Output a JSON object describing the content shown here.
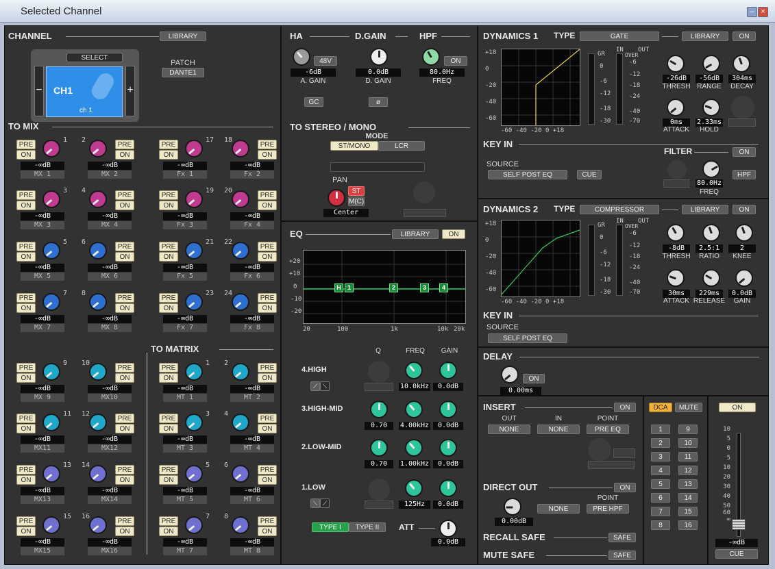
{
  "window": {
    "title": "Selected Channel"
  },
  "channel": {
    "header": "CHANNEL",
    "library": "LIBRARY",
    "select": "SELECT",
    "name": "CH1",
    "sub": "ch 1",
    "patch_label": "PATCH",
    "patch": "DANTE1",
    "minus": "−",
    "plus": "+"
  },
  "to_mix": {
    "header": "TO MIX",
    "pre": "PRE",
    "on": "ON",
    "sends": [
      {
        "num": "1",
        "level": "-∞dB",
        "name": "MX 1",
        "color": "#c03a8f"
      },
      {
        "num": "2",
        "level": "-∞dB",
        "name": "MX 2",
        "color": "#c03a8f"
      },
      {
        "num": "17",
        "level": "-∞dB",
        "name": "Fx 1",
        "color": "#c03a8f"
      },
      {
        "num": "18",
        "level": "-∞dB",
        "name": "Fx 2",
        "color": "#c03a8f"
      },
      {
        "num": "3",
        "level": "-∞dB",
        "name": "MX 3",
        "color": "#c03a8f"
      },
      {
        "num": "4",
        "level": "-∞dB",
        "name": "MX 4",
        "color": "#c03a8f"
      },
      {
        "num": "19",
        "level": "-∞dB",
        "name": "Fx 3",
        "color": "#c03a8f"
      },
      {
        "num": "20",
        "level": "-∞dB",
        "name": "Fx 4",
        "color": "#c03a8f"
      },
      {
        "num": "5",
        "level": "-∞dB",
        "name": "MX 5",
        "color": "#2f6fd0"
      },
      {
        "num": "6",
        "level": "-∞dB",
        "name": "MX 6",
        "color": "#2f6fd0"
      },
      {
        "num": "21",
        "level": "-∞dB",
        "name": "Fx 5",
        "color": "#2f6fd0"
      },
      {
        "num": "22",
        "level": "-∞dB",
        "name": "Fx 6",
        "color": "#2f6fd0"
      },
      {
        "num": "7",
        "level": "-∞dB",
        "name": "MX 7",
        "color": "#2f6fd0"
      },
      {
        "num": "8",
        "level": "-∞dB",
        "name": "MX 8",
        "color": "#2f6fd0"
      },
      {
        "num": "23",
        "level": "-∞dB",
        "name": "Fx 7",
        "color": "#2f6fd0"
      },
      {
        "num": "24",
        "level": "-∞dB",
        "name": "Fx 8",
        "color": "#2f6fd0"
      },
      {
        "num": "9",
        "level": "-∞dB",
        "name": "MX 9",
        "color": "#20a8c8"
      },
      {
        "num": "10",
        "level": "-∞dB",
        "name": "MX10",
        "color": "#20a8c8"
      },
      {
        "num": "1",
        "level": "-∞dB",
        "name": "MT 1",
        "color": "#20a8c8"
      },
      {
        "num": "2",
        "level": "-∞dB",
        "name": "MT 2",
        "color": "#20a8c8"
      },
      {
        "num": "11",
        "level": "-∞dB",
        "name": "MX11",
        "color": "#20a8c8"
      },
      {
        "num": "12",
        "level": "-∞dB",
        "name": "MX12",
        "color": "#20a8c8"
      },
      {
        "num": "3",
        "level": "-∞dB",
        "name": "MT 3",
        "color": "#20a8c8"
      },
      {
        "num": "4",
        "level": "-∞dB",
        "name": "MT 4",
        "color": "#20a8c8"
      },
      {
        "num": "13",
        "level": "-∞dB",
        "name": "MX13",
        "color": "#7070d0"
      },
      {
        "num": "14",
        "level": "-∞dB",
        "name": "MX14",
        "color": "#7070d0"
      },
      {
        "num": "5",
        "level": "-∞dB",
        "name": "MT 5",
        "color": "#7070d0"
      },
      {
        "num": "6",
        "level": "-∞dB",
        "name": "MT 6",
        "color": "#7070d0"
      },
      {
        "num": "15",
        "level": "-∞dB",
        "name": "MX15",
        "color": "#7070d0"
      },
      {
        "num": "16",
        "level": "-∞dB",
        "name": "MX16",
        "color": "#7070d0"
      },
      {
        "num": "7",
        "level": "-∞dB",
        "name": "MT 7",
        "color": "#7070d0"
      },
      {
        "num": "8",
        "level": "-∞dB",
        "name": "MT 8",
        "color": "#7070d0"
      }
    ]
  },
  "to_matrix": {
    "header": "TO MATRIX"
  },
  "ha": {
    "header": "HA",
    "phantom": "48V",
    "gain": "-6dB",
    "gain_label": "A. GAIN",
    "gc": "GC"
  },
  "dgain": {
    "header": "D.GAIN",
    "gain": "0.0dB",
    "gain_label": "D. GAIN",
    "phase": "ø"
  },
  "hpf": {
    "header": "HPF",
    "on": "ON",
    "freq": "80.0Hz",
    "freq_label": "FREQ"
  },
  "stereo": {
    "header": "TO STEREO / MONO",
    "mode_label": "MODE",
    "mode_stmono": "ST/MONO",
    "mode_lcr": "LCR",
    "pan_label": "PAN",
    "st": "ST",
    "mc": "M(C)",
    "pan": "Center"
  },
  "eq": {
    "header": "EQ",
    "library": "LIBRARY",
    "on": "ON",
    "yticks": [
      "+20",
      "+10",
      "0",
      "-10",
      "-20"
    ],
    "xticks": [
      "20",
      "100",
      "1k",
      "10k",
      "20k"
    ],
    "col_q": "Q",
    "col_freq": "FREQ",
    "col_gain": "GAIN",
    "bands": [
      {
        "label": "4.HIGH",
        "q": "",
        "freq": "10.0kHz",
        "gain": "0.0dB"
      },
      {
        "label": "3.HIGH-MID",
        "q": "0.70",
        "freq": "4.00kHz",
        "gain": "0.0dB"
      },
      {
        "label": "2.LOW-MID",
        "q": "0.70",
        "freq": "1.00kHz",
        "gain": "0.0dB"
      },
      {
        "label": "1.LOW",
        "q": "",
        "freq": "125Hz",
        "gain": "0.0dB"
      }
    ],
    "type1": "TYPE I",
    "type2": "TYPE II",
    "att_label": "ATT",
    "att": "0.0dB",
    "handles": [
      "H",
      "1",
      "2",
      "3",
      "4"
    ]
  },
  "dyn1": {
    "header": "DYNAMICS 1",
    "type_label": "TYPE",
    "type": "GATE",
    "library": "LIBRARY",
    "on": "ON",
    "thresh": "-26dB",
    "range": "-56dB",
    "decay": "304ms",
    "attack": "0ms",
    "hold": "2.33ms",
    "l_thresh": "THRESH",
    "l_range": "RANGE",
    "l_decay": "DECAY",
    "l_attack": "ATTACK",
    "l_hold": "HOLD",
    "key_in": "KEY IN",
    "source_label": "SOURCE",
    "source": "SELF POST EQ",
    "cue": "CUE",
    "filter": "FILTER",
    "filter_on": "ON",
    "filter_freq": "80.0Hz",
    "filter_freq_label": "FREQ",
    "hpf": "HPF"
  },
  "dyn2": {
    "header": "DYNAMICS 2",
    "type_label": "TYPE",
    "type": "COMPRESSOR",
    "library": "LIBRARY",
    "on": "ON",
    "thresh": "-8dB",
    "ratio": "2.5:1",
    "knee": "2",
    "attack": "30ms",
    "release": "229ms",
    "gain": "0.0dB",
    "l_thresh": "THRESH",
    "l_ratio": "RATIO",
    "l_knee": "KNEE",
    "l_attack": "ATTACK",
    "l_release": "RELEASE",
    "l_gain": "GAIN",
    "key_in": "KEY IN",
    "source_label": "SOURCE",
    "source": "SELF POST EQ"
  },
  "graph_labels": {
    "y": [
      "+18",
      "0",
      "-20",
      "-40",
      "-60"
    ],
    "x": "-60  -40  -20    0  +18",
    "gr": "GR",
    "in": "IN",
    "out": "OUT",
    "over": "OVER",
    "m1": [
      "0",
      "-6",
      "-12",
      "-18",
      "-30"
    ],
    "m2": [
      "-6",
      "-12",
      "-18",
      "-24",
      "-40",
      "-70"
    ],
    "m3": [
      "-6",
      "-12",
      "-18",
      "-24",
      "-40",
      "-70"
    ]
  },
  "delay": {
    "header": "DELAY",
    "on": "ON",
    "value": "0.00ms"
  },
  "insert": {
    "header": "INSERT",
    "on": "ON",
    "out_label": "OUT",
    "in_label": "IN",
    "point_label": "POINT",
    "out": "NONE",
    "in": "NONE",
    "point": "PRE EQ"
  },
  "direct_out": {
    "header": "DIRECT OUT",
    "on": "ON",
    "point_label": "POINT",
    "level": "0.00dB",
    "patch": "NONE",
    "point": "PRE HPF"
  },
  "recall_safe": {
    "header": "RECALL SAFE",
    "btn": "SAFE"
  },
  "mute_safe": {
    "header": "MUTE SAFE",
    "btn": "SAFE"
  },
  "dca": {
    "dca": "DCA",
    "mute": "MUTE",
    "groups": [
      "1",
      "9",
      "2",
      "10",
      "3",
      "11",
      "4",
      "12",
      "5",
      "13",
      "6",
      "14",
      "7",
      "15",
      "8",
      "16"
    ]
  },
  "fader": {
    "on": "ON",
    "scale": [
      "10",
      "5",
      "0",
      "5",
      "10",
      "20",
      "30",
      "40",
      "50",
      "60",
      "∞"
    ],
    "level": "-∞dB",
    "cue": "CUE"
  }
}
